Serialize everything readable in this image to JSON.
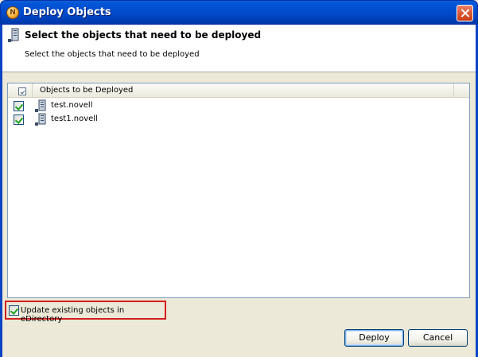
{
  "window": {
    "title": "Deploy Objects",
    "title_icon_glyph": "N"
  },
  "header": {
    "title": "Select the objects that need to be deployed",
    "subtitle": "Select the objects that need to be deployed",
    "icon": "server-icon"
  },
  "table": {
    "column_header": "Objects to be Deployed",
    "rows": [
      {
        "label": "test.novell",
        "checked": true,
        "icon": "server-icon"
      },
      {
        "label": "test1.novell",
        "checked": true,
        "icon": "server-icon"
      }
    ]
  },
  "options": {
    "update_existing_label": "Update existing objects in eDirectory",
    "update_existing_checked": true
  },
  "buttons": {
    "deploy": "Deploy",
    "cancel": "Cancel"
  },
  "colors": {
    "titlebar": "#0148c8",
    "highlight_border": "#d21f1f",
    "dialog_bg": "#ece9d8"
  }
}
